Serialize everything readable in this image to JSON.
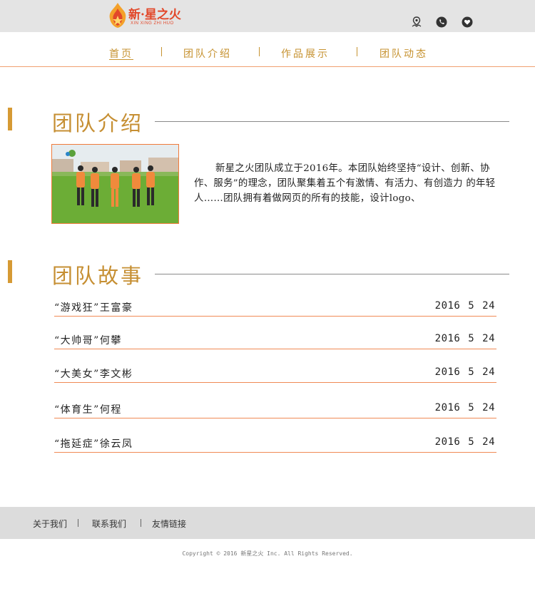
{
  "brand": {
    "name": "新·星之火",
    "subtitle": "XIN XING ZHI HUO",
    "flame_color": "#e2482a"
  },
  "top_icons": [
    "location-icon",
    "phone-icon",
    "heart-icon"
  ],
  "nav": {
    "items": [
      {
        "label": "首页",
        "active": true
      },
      {
        "label": "团队介绍",
        "active": false
      },
      {
        "label": "作品展示",
        "active": false
      },
      {
        "label": "团队动态",
        "active": false
      }
    ],
    "accent": "#c69230"
  },
  "intro": {
    "heading": "团队介绍",
    "text": "新星之火团队成立于2016年。本团队始终坚持“设计、创新、协作、服务”的理念，团队聚集着五个有激情、有活力、有创造力 的年轻人……团队拥有着做网页的所有的技能，设计logo、"
  },
  "stories": {
    "heading": "团队故事",
    "items": [
      {
        "title": "“游戏狂”王富豪",
        "date": "2016 5 24"
      },
      {
        "title": "“大帅哥”何攀",
        "date": "2016 5 24"
      },
      {
        "title": "“大美女”李文彬",
        "date": "2016 5 24"
      },
      {
        "title": "“体育生”何程",
        "date": "2016 5 24"
      },
      {
        "title": "“拖延症”徐云凤",
        "date": "2016 5 24"
      }
    ]
  },
  "footer": {
    "links": [
      "关于我们",
      "联系我们",
      "友情链接"
    ],
    "copyright": "Copyright © 2016 新星之火 Inc. All Rights Reserved."
  },
  "colors": {
    "heading": "#c68f33",
    "divider": "#f08a55",
    "topbar_bg": "#e4e4e4",
    "footer_bg": "#dcdcdc"
  }
}
